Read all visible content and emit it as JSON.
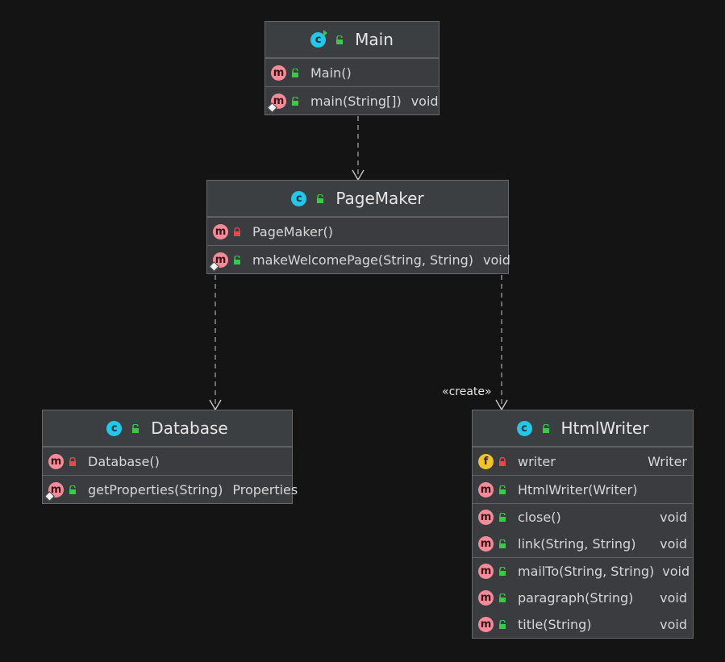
{
  "diagram": {
    "stereotype": "«create»",
    "classes": {
      "main": {
        "name": "Main",
        "members": [
          {
            "label": "Main()",
            "type": ""
          },
          {
            "label": "main(String[])",
            "type": "void"
          }
        ]
      },
      "pagemaker": {
        "name": "PageMaker",
        "members": [
          {
            "label": "PageMaker()",
            "type": ""
          },
          {
            "label": "makeWelcomePage(String, String)",
            "type": "void"
          }
        ]
      },
      "database": {
        "name": "Database",
        "members": [
          {
            "label": "Database()",
            "type": ""
          },
          {
            "label": "getProperties(String)",
            "type": "Properties"
          }
        ]
      },
      "htmlwriter": {
        "name": "HtmlWriter",
        "members": [
          {
            "label": "writer",
            "type": "Writer"
          },
          {
            "label": "HtmlWriter(Writer)",
            "type": ""
          },
          {
            "label": "close()",
            "type": "void"
          },
          {
            "label": "link(String, String)",
            "type": "void"
          },
          {
            "label": "mailTo(String, String)",
            "type": "void"
          },
          {
            "label": "paragraph(String)",
            "type": "void"
          },
          {
            "label": "title(String)",
            "type": "void"
          }
        ]
      }
    },
    "icons": {
      "class": "class-icon",
      "method": "method-icon",
      "field": "field-icon",
      "public": "public-lock-open-icon",
      "private": "private-lock-icon",
      "static": "static-marker-icon"
    },
    "colors": {
      "background": "#141414",
      "box": "#3a3c3f",
      "class_badge": "#25c6e8",
      "method_badge": "#f48b99",
      "field_badge": "#f0c22b",
      "public_lock": "#3ec84a",
      "private_lock": "#e5484d",
      "edge": "#a0a0a0"
    }
  }
}
